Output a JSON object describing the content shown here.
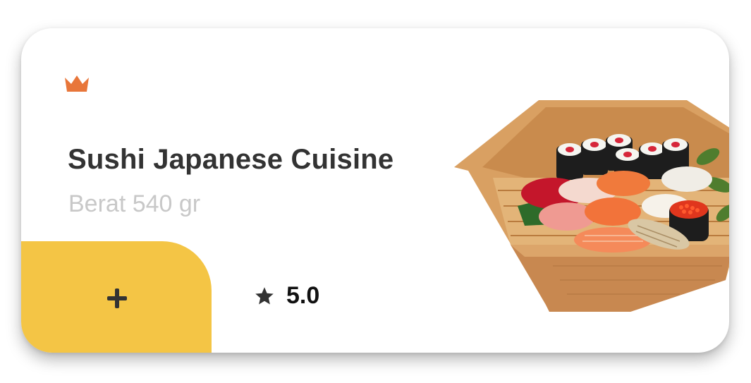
{
  "product": {
    "title": "Sushi Japanese Cuisine",
    "subtitle": "Berat 540 gr",
    "rating": "5.0",
    "icons": {
      "premium": "crown-icon",
      "add": "plus-icon",
      "rating": "star-icon"
    },
    "colors": {
      "accent": "#f4c545",
      "crown": "#e8763a",
      "title": "#333333",
      "subtitle": "#c8c8c8",
      "card": "#ffffff"
    }
  }
}
